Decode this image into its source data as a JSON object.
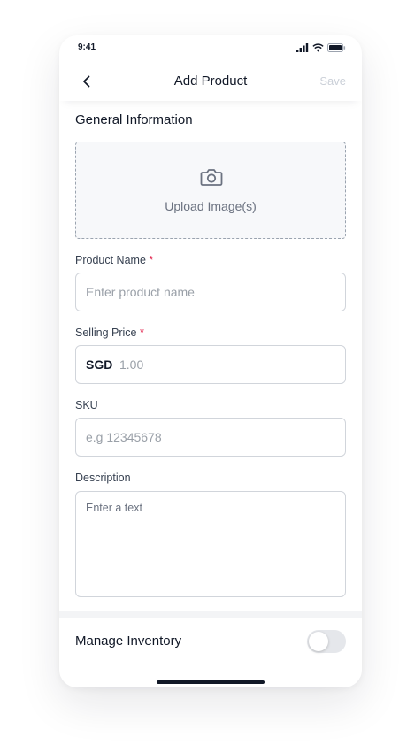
{
  "status_bar": {
    "time": "9:41"
  },
  "nav": {
    "title": "Add Product",
    "save_label": "Save"
  },
  "general_section": {
    "title": "General Information"
  },
  "upload": {
    "label": "Upload Image(s)"
  },
  "fields": {
    "product_name": {
      "label": "Product Name",
      "required_mark": "*",
      "placeholder": "Enter product name"
    },
    "selling_price": {
      "label": "Selling Price",
      "required_mark": "*",
      "currency": "SGD",
      "placeholder": "1.00"
    },
    "sku": {
      "label": "SKU",
      "placeholder": "e.g 12345678"
    },
    "description": {
      "label": "Description",
      "placeholder": "Enter a text"
    }
  },
  "inventory": {
    "label": "Manage Inventory",
    "enabled": false
  },
  "icons": [
    "back-chevron-icon",
    "camera-icon",
    "signal-icon",
    "wifi-icon",
    "battery-icon"
  ],
  "colors": {
    "required": "#e11d48",
    "placeholder": "#9aa0a8",
    "save_disabled": "#cbd0d8",
    "toggle_off": "#e5e7eb"
  }
}
